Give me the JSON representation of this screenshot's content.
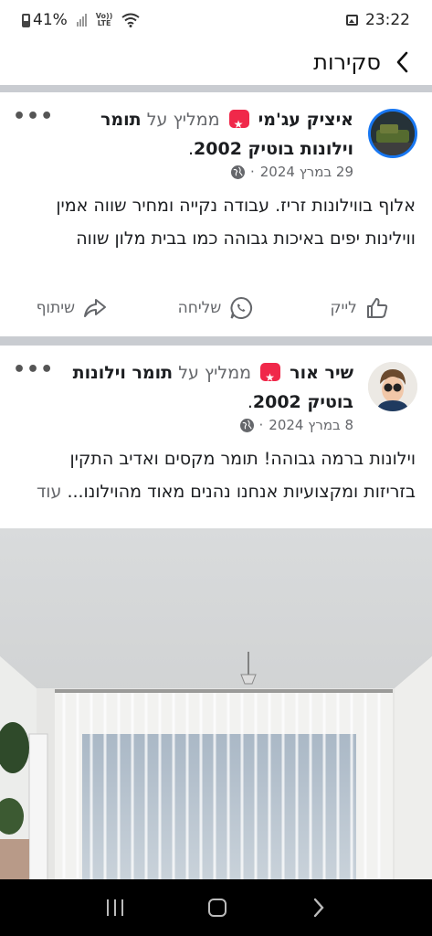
{
  "status_bar": {
    "battery": "41%",
    "volte": "Vo)) LTE",
    "time": "23:22"
  },
  "header": {
    "title": "סקירות"
  },
  "reviews": [
    {
      "reviewer": "איציק עג'מי",
      "recommends": "ממליץ על",
      "page_name": "תומר וילונות בוטיק 2002",
      "date": "29 במרץ 2024",
      "text": "אלוף בווילונות זריז. עבודה נקייה ומחיר שווה אמין ווילינות יפים באיכות גבוהה כמו בבית מלון שווה",
      "more_label": ""
    },
    {
      "reviewer": "שיר אור",
      "recommends": "ממליץ על",
      "page_name": "תומר וילונות בוטיק 2002",
      "date": "8 במרץ 2024",
      "text": "וילונות ברמה גבוהה! תומר מקסים ואדיב התקין בזריזות ומקצועיות אנחנו נהנים מאוד מהוילונו...",
      "more_label": "עוד"
    }
  ],
  "actions": {
    "like": "לייק",
    "send": "שליחה",
    "share": "שיתוף"
  },
  "more_dots": "•••"
}
